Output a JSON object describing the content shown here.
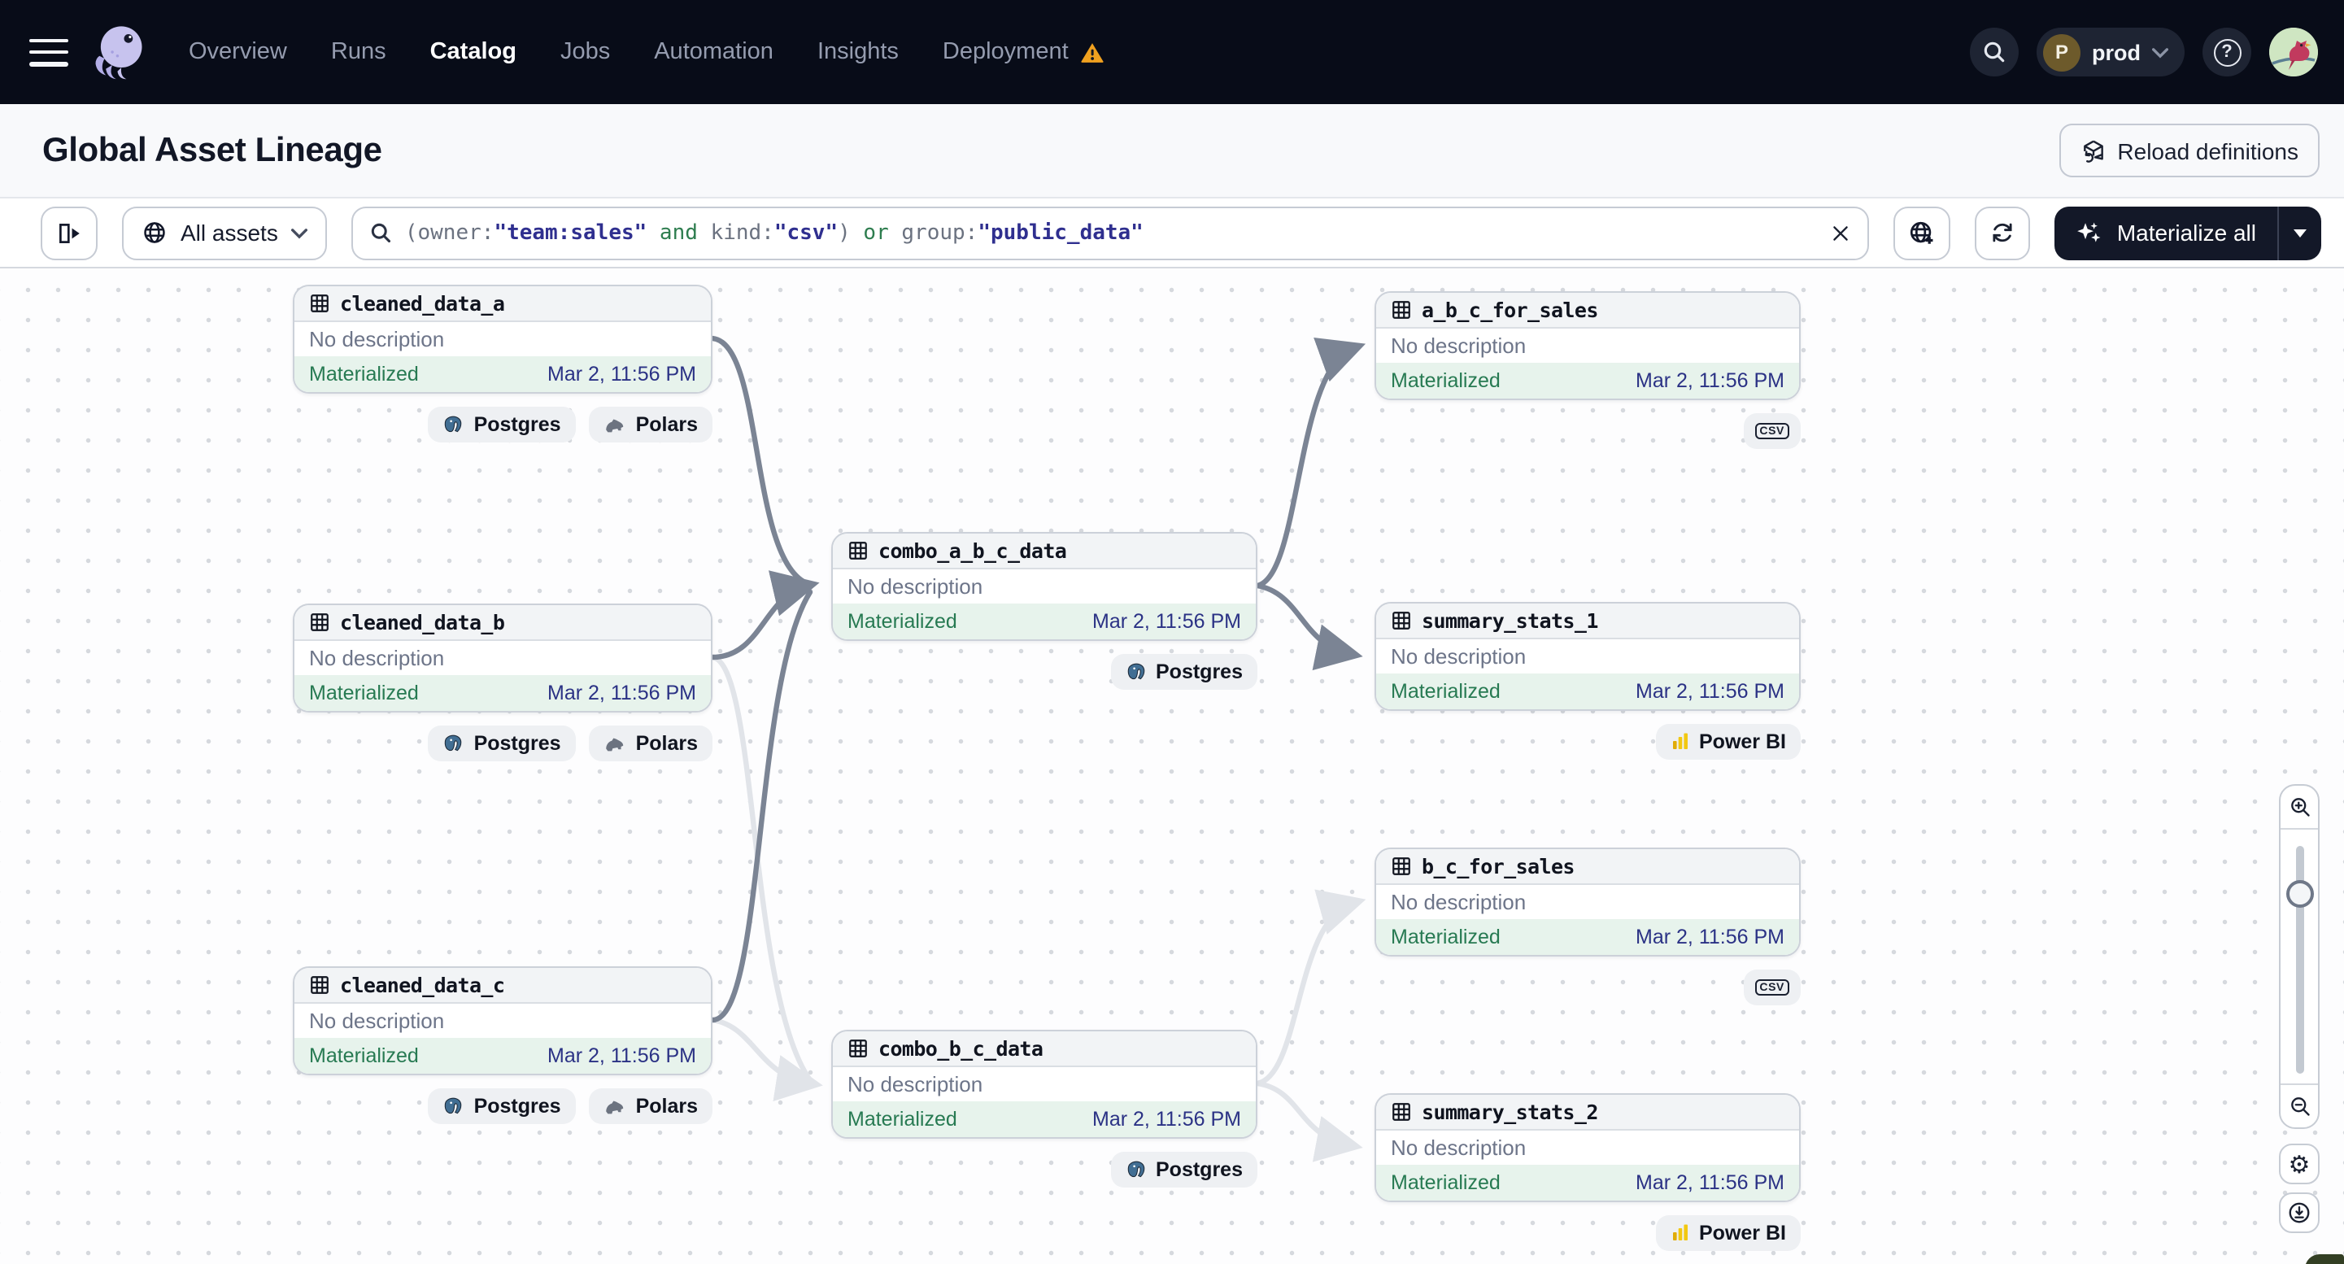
{
  "topnav": {
    "items": [
      {
        "label": "Overview"
      },
      {
        "label": "Runs"
      },
      {
        "label": "Catalog",
        "active": true
      },
      {
        "label": "Jobs"
      },
      {
        "label": "Automation"
      },
      {
        "label": "Insights"
      },
      {
        "label": "Deployment",
        "warning": true
      }
    ],
    "environment": {
      "initial": "P",
      "name": "prod"
    },
    "help_label": "?"
  },
  "page_header": {
    "title": "Global Asset Lineage",
    "reload_button_label": "Reload definitions"
  },
  "toolbar": {
    "asset_filter_label": "All assets",
    "search_tokens": [
      {
        "text": "(",
        "type": "punct"
      },
      {
        "text": "owner:",
        "type": "key"
      },
      {
        "text": "\"team:sales\"",
        "type": "value"
      },
      {
        "text": " and ",
        "type": "op"
      },
      {
        "text": "kind:",
        "type": "key"
      },
      {
        "text": "\"csv\"",
        "type": "value"
      },
      {
        "text": ")",
        "type": "punct"
      },
      {
        "text": " or ",
        "type": "op"
      },
      {
        "text": "group:",
        "type": "key"
      },
      {
        "text": "\"public_data\"",
        "type": "value"
      }
    ],
    "materialize_label": "Materialize all"
  },
  "canvas": {
    "nodes": [
      {
        "name": "cleaned_data_a",
        "description": "No description",
        "status": "Materialized",
        "timestamp": "Mar 2, 11:56 PM",
        "kinds": [
          "Postgres",
          "Polars"
        ]
      },
      {
        "name": "cleaned_data_b",
        "description": "No description",
        "status": "Materialized",
        "timestamp": "Mar 2, 11:56 PM",
        "kinds": [
          "Postgres",
          "Polars"
        ]
      },
      {
        "name": "cleaned_data_c",
        "description": "No description",
        "status": "Materialized",
        "timestamp": "Mar 2, 11:56 PM",
        "kinds": [
          "Postgres",
          "Polars"
        ]
      },
      {
        "name": "combo_a_b_c_data",
        "description": "No description",
        "status": "Materialized",
        "timestamp": "Mar 2, 11:56 PM",
        "kinds": [
          "Postgres"
        ]
      },
      {
        "name": "combo_b_c_data",
        "description": "No description",
        "status": "Materialized",
        "timestamp": "Mar 2, 11:56 PM",
        "kinds": [
          "Postgres"
        ]
      },
      {
        "name": "a_b_c_for_sales",
        "description": "No description",
        "status": "Materialized",
        "timestamp": "Mar 2, 11:56 PM",
        "kinds": [
          "csv"
        ]
      },
      {
        "name": "summary_stats_1",
        "description": "No description",
        "status": "Materialized",
        "timestamp": "Mar 2, 11:56 PM",
        "kinds": [
          "Power BI"
        ]
      },
      {
        "name": "b_c_for_sales",
        "description": "No description",
        "status": "Materialized",
        "timestamp": "Mar 2, 11:56 PM",
        "kinds": [
          "csv"
        ]
      },
      {
        "name": "summary_stats_2",
        "description": "No description",
        "status": "Materialized",
        "timestamp": "Mar 2, 11:56 PM",
        "kinds": [
          "Power BI"
        ]
      }
    ],
    "edges": [
      {
        "from": "cleaned_data_a",
        "to": "combo_a_b_c_data",
        "state": "highlighted"
      },
      {
        "from": "cleaned_data_b",
        "to": "combo_a_b_c_data",
        "state": "highlighted"
      },
      {
        "from": "cleaned_data_c",
        "to": "combo_a_b_c_data",
        "state": "highlighted"
      },
      {
        "from": "combo_a_b_c_data",
        "to": "a_b_c_for_sales",
        "state": "highlighted"
      },
      {
        "from": "combo_a_b_c_data",
        "to": "summary_stats_1",
        "state": "highlighted"
      },
      {
        "from": "cleaned_data_b",
        "to": "combo_b_c_data",
        "state": "dimmed"
      },
      {
        "from": "cleaned_data_c",
        "to": "combo_b_c_data",
        "state": "dimmed"
      },
      {
        "from": "combo_b_c_data",
        "to": "b_c_for_sales",
        "state": "dimmed"
      },
      {
        "from": "combo_b_c_data",
        "to": "summary_stats_2",
        "state": "dimmed"
      }
    ]
  },
  "colors": {
    "nav_background": "#080c18",
    "materialized_green": "#277a52",
    "materialized_bg": "#e7f3ec",
    "timestamp_indigo": "#2b3285",
    "edge_active": "#7b8494",
    "edge_dimmed": "#e1e4e9",
    "warning_orange": "#f0a11f",
    "powerbi_yellow": "#f2c811",
    "postgres_blue": "#416e93"
  }
}
